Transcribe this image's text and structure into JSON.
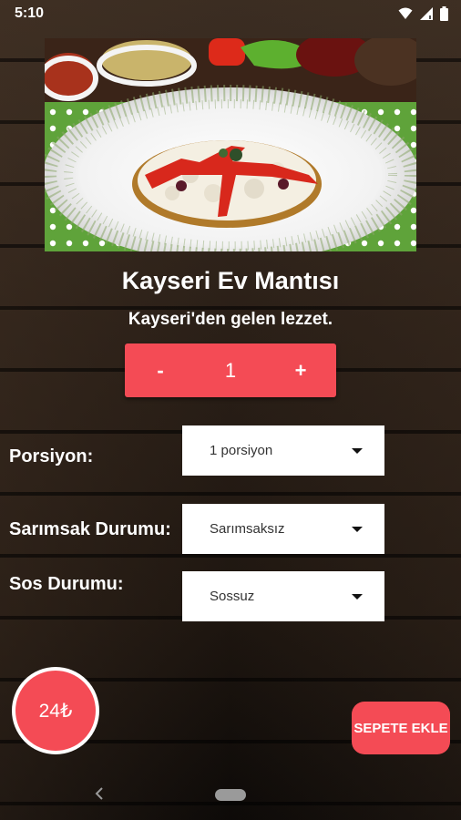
{
  "status_bar": {
    "time": "5:10",
    "icons": [
      "wifi-icon",
      "signal-icon",
      "battery-icon"
    ]
  },
  "dish": {
    "title": "Kayseri Ev Mantısı",
    "subtitle": "Kayseri'den gelen lezzet."
  },
  "quantity": {
    "minus_label": "-",
    "value": "1",
    "plus_label": "+"
  },
  "options": {
    "portion": {
      "label": "Porsiyon:",
      "selected": "1 porsiyon"
    },
    "garlic": {
      "label": "Sarımsak Durumu:",
      "selected": "Sarımsaksız"
    },
    "sauce": {
      "label": "Sos Durumu:",
      "selected": "Sossuz"
    }
  },
  "price": "24₺",
  "add_to_cart_label": "SEPETE EKLE",
  "colors": {
    "accent": "#f44b55",
    "background": "#2a1f17"
  }
}
